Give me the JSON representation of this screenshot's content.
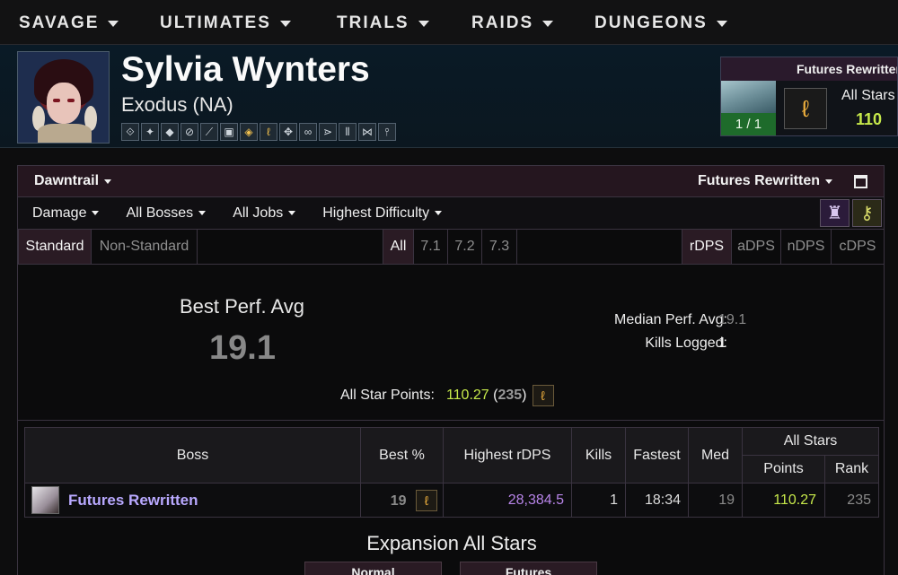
{
  "nav": {
    "items": [
      "SAVAGE",
      "ULTIMATES",
      "TRIALS",
      "RAIDS",
      "DUNGEONS"
    ]
  },
  "character": {
    "name": "Sylvia Wynters",
    "server": "Exodus (NA)",
    "job_icons": [
      "⟐",
      "✦",
      "◆",
      "⊘",
      "⟋",
      "▣",
      "◈",
      "ℓ",
      "✥",
      "∞",
      "⋗",
      "⫴",
      "⋈",
      "⫯"
    ]
  },
  "card": {
    "title": "Futures Rewritten",
    "kills": "1 / 1",
    "allstars_label": "All Stars",
    "allstars_value": "110"
  },
  "panel": {
    "expansion": "Dawntrail",
    "encounter": "Futures Rewritten",
    "filters": [
      "Damage",
      "All Bosses",
      "All Jobs",
      "Highest Difficulty"
    ],
    "modes": [
      "Standard",
      "Non-Standard"
    ],
    "patches": [
      "All",
      "7.1",
      "7.2",
      "7.3"
    ],
    "metrics": [
      "rDPS",
      "aDPS",
      "nDPS",
      "cDPS"
    ]
  },
  "stats": {
    "best_perf_label": "Best Perf. Avg",
    "best_perf_value": "19.1",
    "median_label": "Median Perf. Avg:",
    "median_value": "19.1",
    "kills_label": "Kills Logged:",
    "kills_value": "1",
    "asp_label": "All Star Points:",
    "asp_value": "110.27",
    "asp_rank": "235"
  },
  "table": {
    "headers": {
      "boss": "Boss",
      "best": "Best %",
      "highest": "Highest rDPS",
      "kills": "Kills",
      "fastest": "Fastest",
      "med": "Med",
      "allstars": "All Stars",
      "points": "Points",
      "rank": "Rank"
    },
    "row": {
      "boss": "Futures Rewritten",
      "best": "19",
      "highest": "28,384.5",
      "kills": "1",
      "fastest": "18:34",
      "med": "19",
      "points": "110.27",
      "rank": "235"
    }
  },
  "expansion_all_stars": {
    "title": "Expansion All Stars",
    "tabs": [
      "Normal",
      "Futures"
    ]
  }
}
